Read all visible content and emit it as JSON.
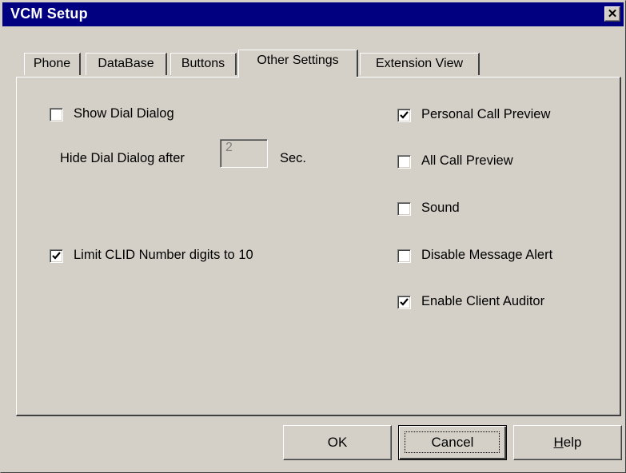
{
  "window": {
    "title": "VCM Setup",
    "close_glyph": "✕"
  },
  "tabs": [
    {
      "label": "Phone"
    },
    {
      "label": "DataBase"
    },
    {
      "label": "Buttons"
    },
    {
      "label": "Other Settings"
    },
    {
      "label": "Extension View"
    }
  ],
  "active_tab": "Other Settings",
  "settings": {
    "show_dial_dialog": {
      "label": "Show Dial Dialog",
      "checked": false
    },
    "hide_dial": {
      "label": "Hide Dial Dialog after",
      "value": "2",
      "unit": "Sec."
    },
    "limit_clid": {
      "label": "Limit CLID Number digits to 10",
      "checked": true
    },
    "personal_call_preview": {
      "label": "Personal Call Preview",
      "checked": true
    },
    "all_call_preview": {
      "label": "All Call Preview",
      "checked": false
    },
    "sound": {
      "label": "Sound",
      "checked": false
    },
    "disable_message_alert": {
      "label": "Disable Message Alert",
      "checked": false
    },
    "enable_client_auditor": {
      "label": "Enable Client Auditor",
      "checked": true
    }
  },
  "buttons": {
    "ok": "OK",
    "cancel": "Cancel",
    "help_underline": "H",
    "help_rest": "elp"
  },
  "colors": {
    "titlebar": "#000080",
    "face": "#d4d0c8"
  },
  "icons": {
    "check": "check-mark-icon",
    "close": "close-icon"
  }
}
